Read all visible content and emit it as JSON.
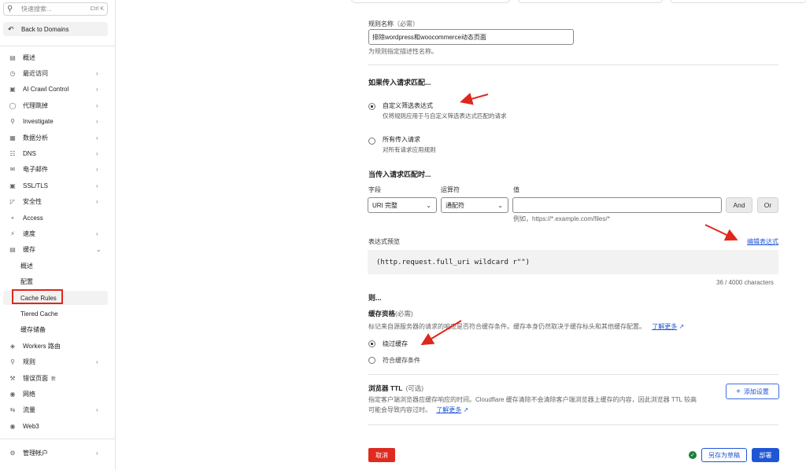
{
  "sidebar": {
    "search_placeholder": "快速搜索...",
    "search_shortcut": "Ctrl K",
    "back_label": "Back to Domains",
    "items": [
      {
        "label": "概述",
        "icon": "document-icon",
        "chevron": false
      },
      {
        "label": "最近访问",
        "icon": "clock-icon",
        "chevron": true
      },
      {
        "label": "AI Crawl Control",
        "icon": "robot-icon",
        "chevron": true
      },
      {
        "label": "代理跳掉",
        "icon": "globe-icon",
        "chevron": true
      },
      {
        "label": "Investigate",
        "icon": "magnifier-icon",
        "chevron": true
      },
      {
        "label": "数据分析",
        "icon": "chart-icon",
        "chevron": true
      },
      {
        "label": "DNS",
        "icon": "dns-icon",
        "chevron": true
      },
      {
        "label": "电子邮件",
        "icon": "mail-icon",
        "chevron": true
      },
      {
        "label": "SSL/TLS",
        "icon": "lock-icon",
        "chevron": true
      },
      {
        "label": "安全性",
        "icon": "shield-icon",
        "chevron": true
      },
      {
        "label": "Access",
        "icon": "access-icon",
        "chevron": false
      },
      {
        "label": "速度",
        "icon": "lightning-icon",
        "chevron": true
      },
      {
        "label": "缓存",
        "icon": "cache-icon",
        "chevron": true,
        "expanded": true
      }
    ],
    "cache_sub": [
      {
        "label": "概述"
      },
      {
        "label": "配置"
      },
      {
        "label": "Cache Rules",
        "active": true
      },
      {
        "label": "Tiered Cache"
      },
      {
        "label": "缓存储备"
      }
    ],
    "items_after": [
      {
        "label": "Workers 路由",
        "icon": "workers-icon",
        "chevron": false
      },
      {
        "label": "规则",
        "icon": "rules-icon",
        "chevron": true
      },
      {
        "label": "错误页面",
        "icon": "wrench-icon",
        "chevron": false,
        "badge": "新"
      },
      {
        "label": "网络",
        "icon": "pin-icon",
        "chevron": false
      },
      {
        "label": "流量",
        "icon": "traffic-icon",
        "chevron": true
      },
      {
        "label": "Web3",
        "icon": "web3-icon",
        "chevron": false
      }
    ],
    "account": {
      "label": "管理帐户",
      "icon": "gear-icon"
    }
  },
  "rule_name": {
    "label": "规则名称",
    "required": "（必需）",
    "value": "排除wordpress和woocommerce动态页面",
    "help": "为规则指定描述性名称。"
  },
  "match": {
    "heading": "如果传入请求匹配...",
    "option_custom_title": "自定义筛选表达式",
    "option_custom_desc": "仅将规则应用于与自定义筛选表达式匹配的请求",
    "option_all_title": "所有传入请求",
    "option_all_desc": "对所有请求应用规则"
  },
  "when": {
    "heading": "当传入请求匹配时...",
    "field_label": "字段",
    "operator_label": "运算符",
    "value_label": "值",
    "field_value": "URI 完整",
    "operator_value": "通配符",
    "value_hint": "例如，https://*.example.com/files/*",
    "and_label": "And",
    "or_label": "Or"
  },
  "preview": {
    "label": "表达式预览",
    "edit_link": "编辑表达式",
    "expression": "(http.request.full_uri wildcard r\"\")",
    "count": "36 / 4000 characters"
  },
  "then": {
    "heading": "则...",
    "eligibility_title": "缓存资格",
    "eligibility_required": "(必需)",
    "eligibility_desc": "标记来自源服务器的请求的响应是否符合缓存条件。缓存本身仍然取决于缓存标头和其他缓存配置。",
    "learn_more": "了解更多",
    "option_bypass": "绕过缓存",
    "option_eligible": "符合缓存条件"
  },
  "ttl": {
    "title": "浏览器 TTL",
    "optional": "(可选)",
    "desc_line1": "指定客户端浏览器应缓存响应的时间。Cloudflare 缓存清除不会清除客户端浏览器上缓存的内容，因此浏览器 TTL 较高",
    "desc_line2": "可能会导致内容过时。",
    "learn_more": "了解更多",
    "add_label": "添加设置"
  },
  "footer": {
    "cancel": "取消",
    "save_draft": "另存为草稿",
    "deploy": "部署"
  },
  "colors": {
    "accent": "#1f56d6",
    "danger": "#df2a1f",
    "annotation": "#e0271d"
  }
}
